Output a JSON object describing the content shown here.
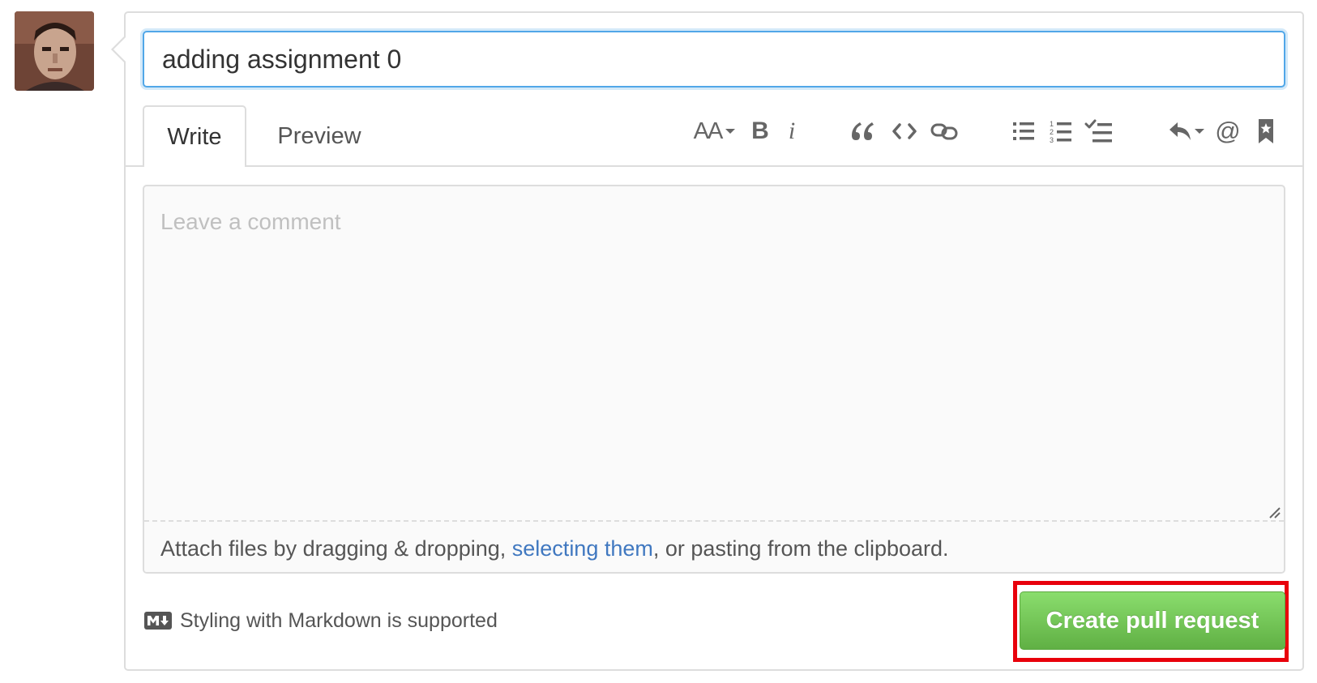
{
  "pull_request": {
    "title_value": "adding assignment 0"
  },
  "tabs": {
    "write_label": "Write",
    "preview_label": "Preview"
  },
  "toolbar": {
    "header_label": "AA",
    "bold_label": "B",
    "italic_label": "i",
    "mention_label": "@",
    "icons": [
      "header-dropdown",
      "bold",
      "italic",
      "quote",
      "code",
      "link",
      "unordered-list",
      "ordered-list",
      "task-list",
      "reply-dropdown",
      "mention",
      "saved-replies"
    ]
  },
  "comment": {
    "placeholder": "Leave a comment",
    "attach_prefix": "Attach files by dragging & dropping, ",
    "attach_link": "selecting them",
    "attach_suffix": ", or pasting from the clipboard."
  },
  "footer": {
    "markdown_help": "Styling with Markdown is supported",
    "create_button": "Create pull request"
  },
  "colors": {
    "create_button": "#60b044",
    "focus_border": "#51a7e8",
    "link": "#4078c0",
    "highlight": "#e8000b"
  }
}
